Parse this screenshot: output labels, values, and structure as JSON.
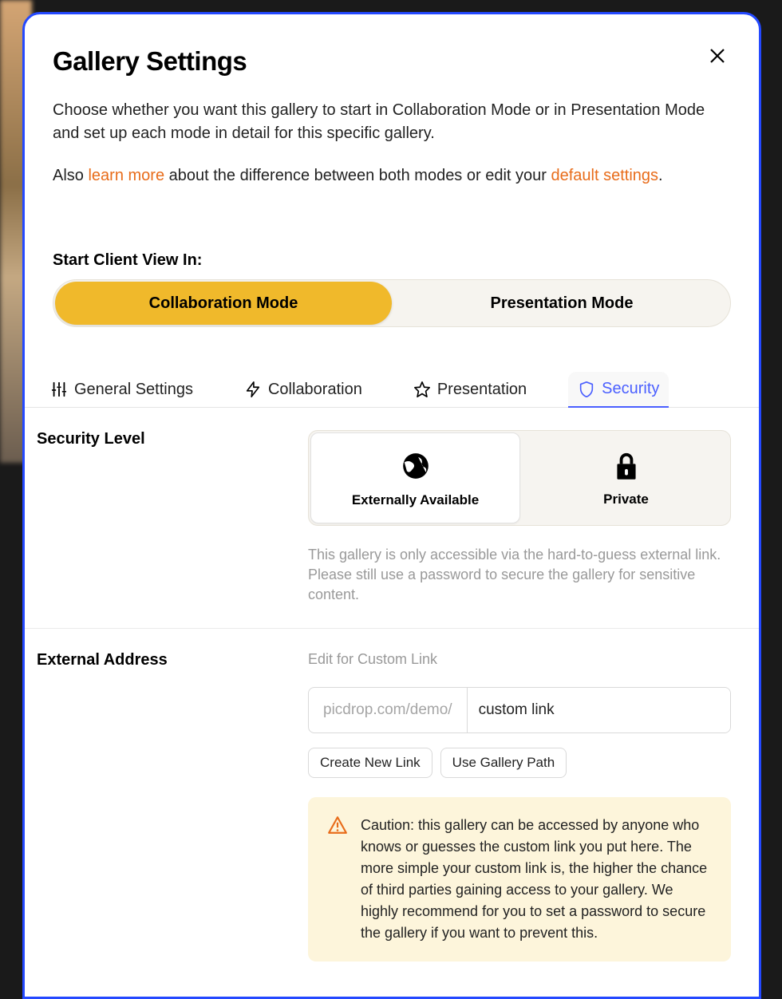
{
  "header": {
    "title": "Gallery Settings",
    "intro_prefix": "Choose whether you want this gallery to start in Collaboration Mode or in Presentation Mode and set up each mode in detail for this specific gallery.",
    "sub_pre": "Also ",
    "learn_more": "learn more",
    "sub_mid": " about the difference between both modes or edit your ",
    "default_settings": "default settings",
    "sub_end": "."
  },
  "start_view": {
    "label": "Start Client View In:",
    "options": [
      "Collaboration Mode",
      "Presentation Mode"
    ],
    "active": 0
  },
  "tabs": {
    "items": [
      {
        "label": "General Settings",
        "icon": "sliders"
      },
      {
        "label": "Collaboration",
        "icon": "bolt"
      },
      {
        "label": "Presentation",
        "icon": "star"
      },
      {
        "label": "Security",
        "icon": "shield"
      }
    ],
    "active": 3
  },
  "security": {
    "section_label": "Security Level",
    "options": [
      {
        "label": "Externally Available",
        "icon": "globe"
      },
      {
        "label": "Private",
        "icon": "lock"
      }
    ],
    "active": 0,
    "description": "This gallery is only accessible via the hard-to-guess external link. Please still use a password to secure the gallery for sensitive content."
  },
  "external": {
    "section_label": "External Address",
    "hint": "Edit for Custom Link",
    "prefix": "picdrop.com/demo/",
    "value": "custom link",
    "buttons": [
      "Create New Link",
      "Use Gallery Path"
    ],
    "warning": "Caution: this gallery can be accessed by anyone who knows or guesses the custom link you put here. The more simple your custom link is, the higher the chance of third parties gaining access to your gallery. We highly recommend for you to set a password to secure the gallery if you want to prevent this."
  }
}
